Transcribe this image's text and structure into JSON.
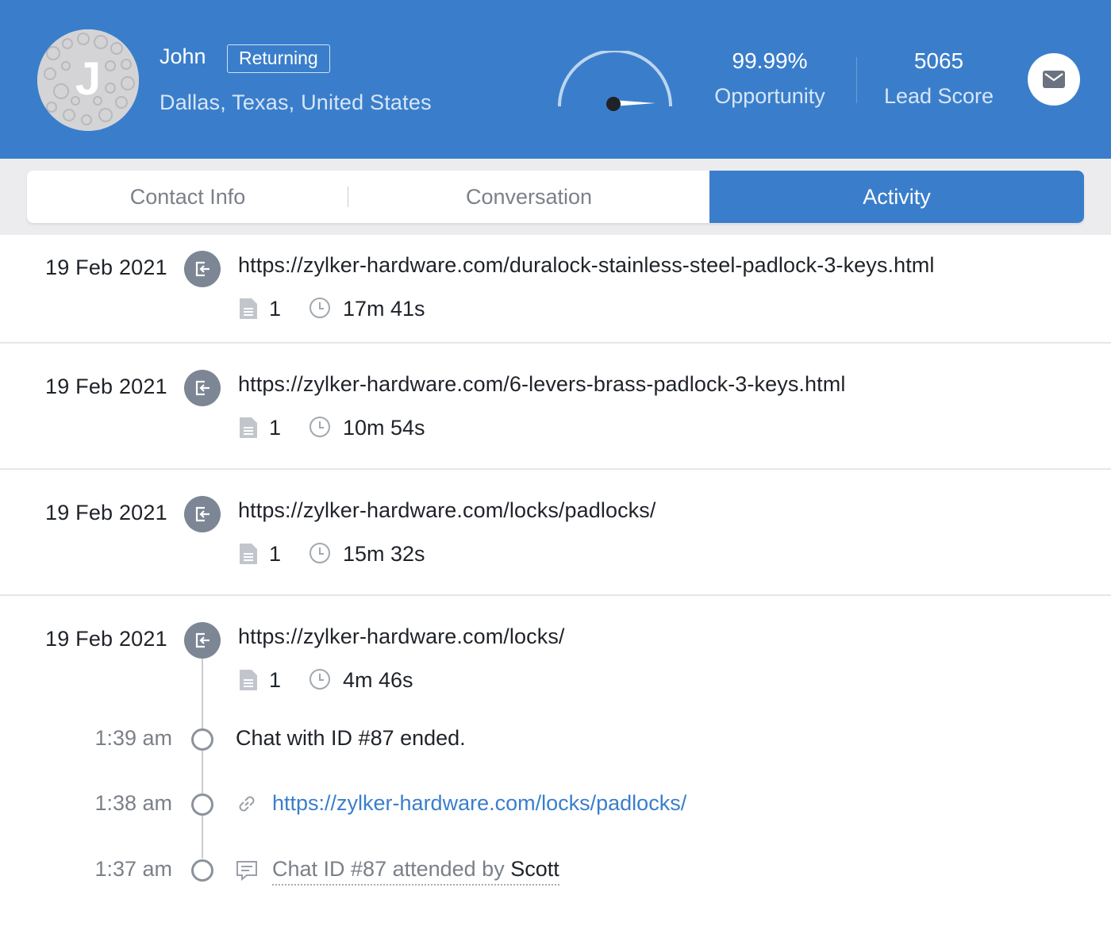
{
  "visitor": {
    "name": "John",
    "status_badge": "Returning",
    "location": "Dallas, Texas, United States",
    "avatar_letter": "J"
  },
  "metrics": {
    "opportunity_value": "99.99%",
    "opportunity_label": "Opportunity",
    "lead_score_value": "5065",
    "lead_score_label": "Lead Score"
  },
  "tabs": [
    {
      "label": "Contact Info",
      "active": false
    },
    {
      "label": "Conversation",
      "active": false
    },
    {
      "label": "Activity",
      "active": true
    }
  ],
  "activity": [
    {
      "date": "19 Feb 2021",
      "url": "https://zylker-hardware.com/duralock-stainless-steel-padlock-3-keys.html",
      "page_count": "1",
      "duration": "17m 41s"
    },
    {
      "date": "19 Feb 2021",
      "url": "https://zylker-hardware.com/6-levers-brass-padlock-3-keys.html",
      "page_count": "1",
      "duration": "10m 54s"
    },
    {
      "date": "19 Feb 2021",
      "url": "https://zylker-hardware.com/locks/padlocks/",
      "page_count": "1",
      "duration": "15m 32s"
    },
    {
      "date": "19 Feb 2021",
      "url": "https://zylker-hardware.com/locks/",
      "page_count": "1",
      "duration": "4m 46s"
    }
  ],
  "timeline": [
    {
      "time": "1:39 am",
      "text": "Chat with ID #87 ended."
    },
    {
      "time": "1:38 am",
      "link": "https://zylker-hardware.com/locks/padlocks/"
    },
    {
      "time": "1:37 am",
      "text_prefix": "Chat ID #87 attended by",
      "agent": "Scott"
    }
  ],
  "colors": {
    "header_bg": "#3a7ecb",
    "active_tab": "#3a7ecb",
    "link": "#3a7ecb",
    "icon_gray": "#7c8694"
  },
  "icons": [
    "exit-page-icon",
    "document-icon",
    "clock-icon",
    "link-icon",
    "chat-bubble-icon",
    "mail-icon",
    "gauge-icon"
  ]
}
